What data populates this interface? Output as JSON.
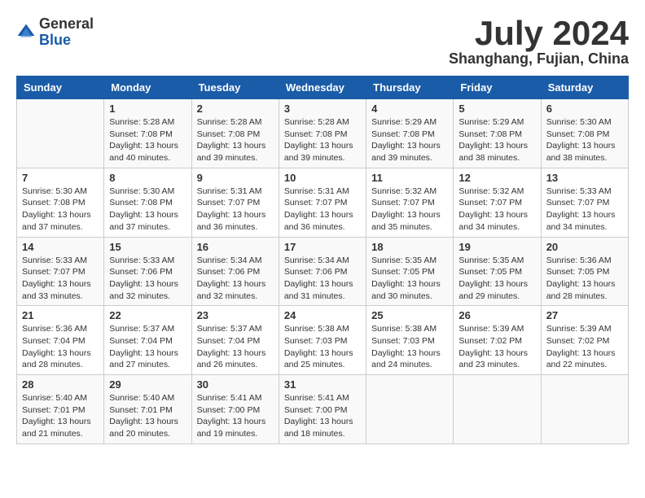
{
  "header": {
    "logo_general": "General",
    "logo_blue": "Blue",
    "month_year": "July 2024",
    "location": "Shanghang, Fujian, China"
  },
  "days_of_week": [
    "Sunday",
    "Monday",
    "Tuesday",
    "Wednesday",
    "Thursday",
    "Friday",
    "Saturday"
  ],
  "weeks": [
    [
      {
        "day": "",
        "info": ""
      },
      {
        "day": "1",
        "info": "Sunrise: 5:28 AM\nSunset: 7:08 PM\nDaylight: 13 hours\nand 40 minutes."
      },
      {
        "day": "2",
        "info": "Sunrise: 5:28 AM\nSunset: 7:08 PM\nDaylight: 13 hours\nand 39 minutes."
      },
      {
        "day": "3",
        "info": "Sunrise: 5:28 AM\nSunset: 7:08 PM\nDaylight: 13 hours\nand 39 minutes."
      },
      {
        "day": "4",
        "info": "Sunrise: 5:29 AM\nSunset: 7:08 PM\nDaylight: 13 hours\nand 39 minutes."
      },
      {
        "day": "5",
        "info": "Sunrise: 5:29 AM\nSunset: 7:08 PM\nDaylight: 13 hours\nand 38 minutes."
      },
      {
        "day": "6",
        "info": "Sunrise: 5:30 AM\nSunset: 7:08 PM\nDaylight: 13 hours\nand 38 minutes."
      }
    ],
    [
      {
        "day": "7",
        "info": "Sunrise: 5:30 AM\nSunset: 7:08 PM\nDaylight: 13 hours\nand 37 minutes."
      },
      {
        "day": "8",
        "info": "Sunrise: 5:30 AM\nSunset: 7:08 PM\nDaylight: 13 hours\nand 37 minutes."
      },
      {
        "day": "9",
        "info": "Sunrise: 5:31 AM\nSunset: 7:07 PM\nDaylight: 13 hours\nand 36 minutes."
      },
      {
        "day": "10",
        "info": "Sunrise: 5:31 AM\nSunset: 7:07 PM\nDaylight: 13 hours\nand 36 minutes."
      },
      {
        "day": "11",
        "info": "Sunrise: 5:32 AM\nSunset: 7:07 PM\nDaylight: 13 hours\nand 35 minutes."
      },
      {
        "day": "12",
        "info": "Sunrise: 5:32 AM\nSunset: 7:07 PM\nDaylight: 13 hours\nand 34 minutes."
      },
      {
        "day": "13",
        "info": "Sunrise: 5:33 AM\nSunset: 7:07 PM\nDaylight: 13 hours\nand 34 minutes."
      }
    ],
    [
      {
        "day": "14",
        "info": "Sunrise: 5:33 AM\nSunset: 7:07 PM\nDaylight: 13 hours\nand 33 minutes."
      },
      {
        "day": "15",
        "info": "Sunrise: 5:33 AM\nSunset: 7:06 PM\nDaylight: 13 hours\nand 32 minutes."
      },
      {
        "day": "16",
        "info": "Sunrise: 5:34 AM\nSunset: 7:06 PM\nDaylight: 13 hours\nand 32 minutes."
      },
      {
        "day": "17",
        "info": "Sunrise: 5:34 AM\nSunset: 7:06 PM\nDaylight: 13 hours\nand 31 minutes."
      },
      {
        "day": "18",
        "info": "Sunrise: 5:35 AM\nSunset: 7:05 PM\nDaylight: 13 hours\nand 30 minutes."
      },
      {
        "day": "19",
        "info": "Sunrise: 5:35 AM\nSunset: 7:05 PM\nDaylight: 13 hours\nand 29 minutes."
      },
      {
        "day": "20",
        "info": "Sunrise: 5:36 AM\nSunset: 7:05 PM\nDaylight: 13 hours\nand 28 minutes."
      }
    ],
    [
      {
        "day": "21",
        "info": "Sunrise: 5:36 AM\nSunset: 7:04 PM\nDaylight: 13 hours\nand 28 minutes."
      },
      {
        "day": "22",
        "info": "Sunrise: 5:37 AM\nSunset: 7:04 PM\nDaylight: 13 hours\nand 27 minutes."
      },
      {
        "day": "23",
        "info": "Sunrise: 5:37 AM\nSunset: 7:04 PM\nDaylight: 13 hours\nand 26 minutes."
      },
      {
        "day": "24",
        "info": "Sunrise: 5:38 AM\nSunset: 7:03 PM\nDaylight: 13 hours\nand 25 minutes."
      },
      {
        "day": "25",
        "info": "Sunrise: 5:38 AM\nSunset: 7:03 PM\nDaylight: 13 hours\nand 24 minutes."
      },
      {
        "day": "26",
        "info": "Sunrise: 5:39 AM\nSunset: 7:02 PM\nDaylight: 13 hours\nand 23 minutes."
      },
      {
        "day": "27",
        "info": "Sunrise: 5:39 AM\nSunset: 7:02 PM\nDaylight: 13 hours\nand 22 minutes."
      }
    ],
    [
      {
        "day": "28",
        "info": "Sunrise: 5:40 AM\nSunset: 7:01 PM\nDaylight: 13 hours\nand 21 minutes."
      },
      {
        "day": "29",
        "info": "Sunrise: 5:40 AM\nSunset: 7:01 PM\nDaylight: 13 hours\nand 20 minutes."
      },
      {
        "day": "30",
        "info": "Sunrise: 5:41 AM\nSunset: 7:00 PM\nDaylight: 13 hours\nand 19 minutes."
      },
      {
        "day": "31",
        "info": "Sunrise: 5:41 AM\nSunset: 7:00 PM\nDaylight: 13 hours\nand 18 minutes."
      },
      {
        "day": "",
        "info": ""
      },
      {
        "day": "",
        "info": ""
      },
      {
        "day": "",
        "info": ""
      }
    ]
  ]
}
